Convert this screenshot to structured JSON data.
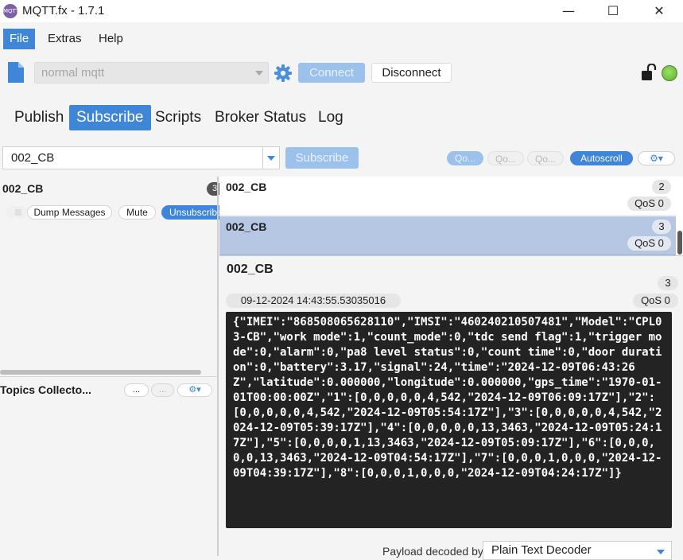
{
  "window": {
    "title": "MQTT.fx - 1.7.1",
    "app_icon_text": "MQTT",
    "minimize_glyph": "—",
    "maximize_glyph": "☐",
    "close_glyph": "✕"
  },
  "menu": {
    "items": [
      "File",
      "Extras",
      "Help"
    ],
    "active": "File"
  },
  "toolbar": {
    "profile": "normal mqtt",
    "connect_label": "Connect",
    "disconnect_label": "Disconnect",
    "status_color": "#5ab52a"
  },
  "tabs": {
    "items": [
      "Publish",
      "Subscribe",
      "Scripts",
      "Broker Status",
      "Log"
    ],
    "active": "Subscribe"
  },
  "subscribe_bar": {
    "topic_value": "002_CB",
    "subscribe_label": "Subscribe",
    "qos_buttons": [
      "Qo...",
      "Qo...",
      "Qo..."
    ],
    "autoscroll_label": "Autoscroll",
    "settings_icon": "gear-icon"
  },
  "subscriptions": {
    "topic": "002_CB",
    "count": "3",
    "dump_label": "Dump Messages",
    "mute_label": "Mute",
    "unsubscribe_label": "Unsubscribe"
  },
  "topics_collector": {
    "label": "Topics Collecto...",
    "more_label": "...",
    "more2_label": "..."
  },
  "messages": [
    {
      "topic": "002_CB",
      "number": "2",
      "qos": "QoS 0"
    },
    {
      "topic": "002_CB",
      "number": "3",
      "qos": "QoS 0"
    }
  ],
  "detail": {
    "topic": "002_CB",
    "number": "3",
    "timestamp": "09-12-2024  14:43:55.53035016",
    "qos": "QoS 0",
    "payload": "{\"IMEI\":\"868508065628110\",\"IMSI\":\"460240210507481\",\"Model\":\"CPL03-CB\",\"work mode\":1,\"count_mode\":0,\"tdc send flag\":1,\"trigger mode\":0,\"alarm\":0,\"pa8 level status\":0,\"count time\":0,\"door duration\":0,\"battery\":3.17,\"signal\":24,\"time\":\"2024-12-09T06:43:26Z\",\"latitude\":0.000000,\"longitude\":0.000000,\"gps_time\":\"1970-01-01T00:00:00Z\",\"1\":[0,0,0,0,0,4,542,\"2024-12-09T06:09:17Z\"],\"2\":[0,0,0,0,0,4,542,\"2024-12-09T05:54:17Z\"],\"3\":[0,0,0,0,0,4,542,\"2024-12-09T05:39:17Z\"],\"4\":[0,0,0,0,0,13,3463,\"2024-12-09T05:24:17Z\"],\"5\":[0,0,0,0,1,13,3463,\"2024-12-09T05:09:17Z\"],\"6\":[0,0,0,0,0,13,3463,\"2024-12-09T04:54:17Z\"],\"7\":[0,0,0,1,0,0,0,\"2024-12-09T04:39:17Z\"],\"8\":[0,0,0,1,0,0,0,\"2024-12-09T04:24:17Z\"]}"
  },
  "decoder": {
    "label": "Payload decoded by",
    "value": "Plain Text Decoder"
  },
  "colors": {
    "accent": "#3f86d8",
    "accent_disabled": "#9cc2ec",
    "selected_row": "#b5c7e3",
    "payload_bg": "#232323"
  }
}
